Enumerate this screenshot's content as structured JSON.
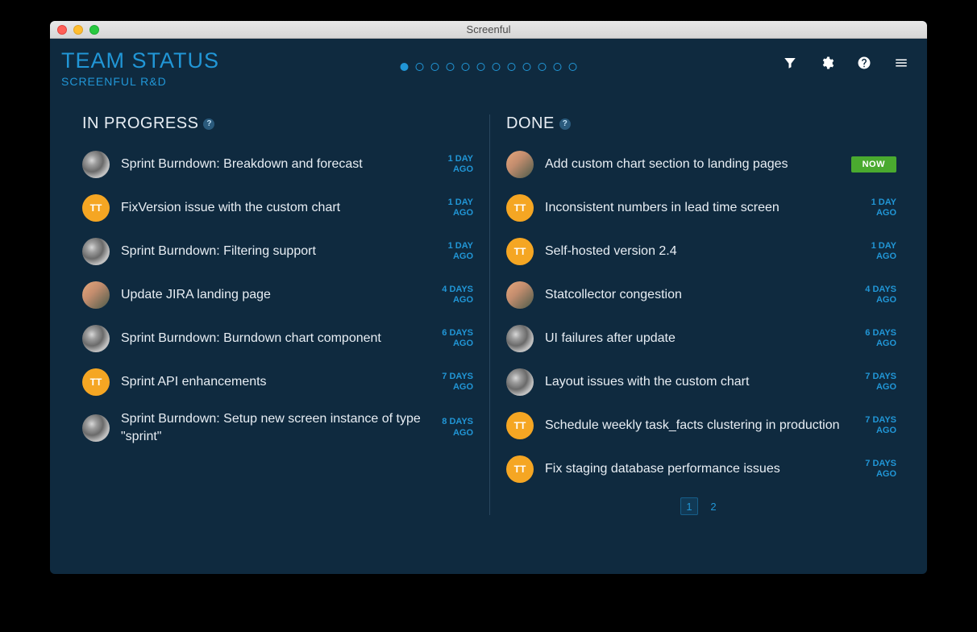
{
  "window_title": "Screenful",
  "header": {
    "title": "TEAM STATUS",
    "subtitle": "SCREENFUL R&D"
  },
  "pager": {
    "count": 12,
    "active": 0
  },
  "columns": {
    "in_progress": {
      "title": "IN PROGRESS",
      "items": [
        {
          "avatar": "gray",
          "initials": "",
          "title": "Sprint Burndown: Breakdown and forecast",
          "ago_top": "1 DAY",
          "ago_bot": "AGO"
        },
        {
          "avatar": "tt",
          "initials": "TT",
          "title": "FixVersion issue with the custom chart",
          "ago_top": "1 DAY",
          "ago_bot": "AGO"
        },
        {
          "avatar": "gray",
          "initials": "",
          "title": "Sprint Burndown: Filtering support",
          "ago_top": "1 DAY",
          "ago_bot": "AGO"
        },
        {
          "avatar": "photo",
          "initials": "",
          "title": "Update JIRA landing page",
          "ago_top": "4 DAYS",
          "ago_bot": "AGO"
        },
        {
          "avatar": "gray",
          "initials": "",
          "title": "Sprint Burndown: Burndown chart component",
          "ago_top": "6 DAYS",
          "ago_bot": "AGO"
        },
        {
          "avatar": "tt",
          "initials": "TT",
          "title": "Sprint API enhancements",
          "ago_top": "7 DAYS",
          "ago_bot": "AGO"
        },
        {
          "avatar": "gray",
          "initials": "",
          "title": "Sprint Burndown: Setup new screen instance of type \"sprint\"",
          "ago_top": "8 DAYS",
          "ago_bot": "AGO"
        }
      ]
    },
    "done": {
      "title": "DONE",
      "items": [
        {
          "avatar": "photo",
          "initials": "",
          "title": "Add custom chart section to landing pages",
          "now": true,
          "now_label": "NOW"
        },
        {
          "avatar": "tt",
          "initials": "TT",
          "title": "Inconsistent numbers in lead time screen",
          "ago_top": "1 DAY",
          "ago_bot": "AGO"
        },
        {
          "avatar": "tt",
          "initials": "TT",
          "title": "Self-hosted version 2.4",
          "ago_top": "1 DAY",
          "ago_bot": "AGO"
        },
        {
          "avatar": "photo",
          "initials": "",
          "title": "Statcollector congestion",
          "ago_top": "4 DAYS",
          "ago_bot": "AGO"
        },
        {
          "avatar": "gray",
          "initials": "",
          "title": "UI failures after update",
          "ago_top": "6 DAYS",
          "ago_bot": "AGO"
        },
        {
          "avatar": "gray",
          "initials": "",
          "title": "Layout issues with the custom chart",
          "ago_top": "7 DAYS",
          "ago_bot": "AGO"
        },
        {
          "avatar": "tt",
          "initials": "TT",
          "title": "Schedule weekly task_facts clustering in production",
          "ago_top": "7 DAYS",
          "ago_bot": "AGO"
        },
        {
          "avatar": "tt",
          "initials": "TT",
          "title": "Fix staging database performance issues",
          "ago_top": "7 DAYS",
          "ago_bot": "AGO"
        }
      ],
      "pages": [
        "1",
        "2"
      ],
      "active_page": 0
    }
  }
}
